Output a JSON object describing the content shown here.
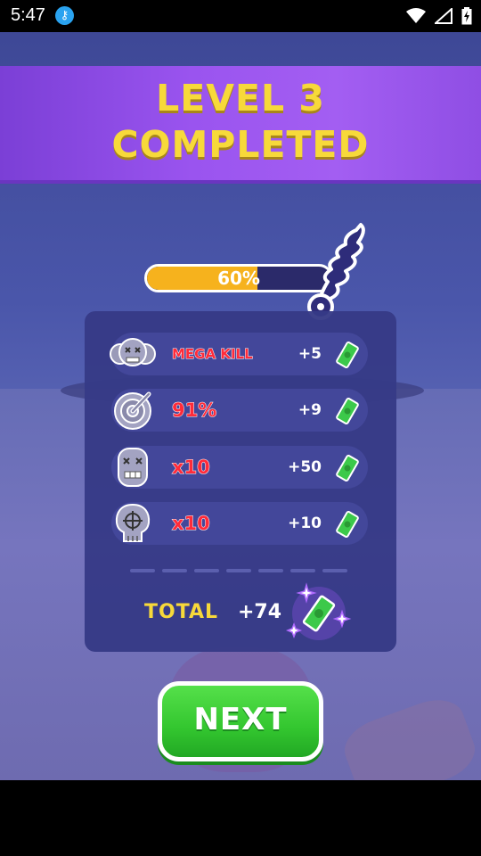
{
  "status_bar": {
    "time": "5:47"
  },
  "banner": {
    "line1": "LEVEL 3",
    "line2": "COMPLETED"
  },
  "progress": {
    "percent_label": "60%",
    "fraction": 0.6
  },
  "rewards": [
    {
      "label": "MEGA KILL",
      "value": "+5",
      "icon": "zombie-group-icon"
    },
    {
      "label": "91%",
      "value": "+9",
      "icon": "target-icon"
    },
    {
      "label": "x10",
      "value": "+50",
      "icon": "zombie-head-icon"
    },
    {
      "label": "x10",
      "value": "+10",
      "icon": "skull-crosshair-icon"
    }
  ],
  "total": {
    "label": "TOTAL",
    "value": "+74"
  },
  "next_button": {
    "label": "NEXT"
  },
  "colors": {
    "banner_text": "#f7d93a",
    "reward_label": "#ff2b3a",
    "progress_fill": "#f6b21d",
    "next_button": "#33c62f",
    "cash": "#3cc94a"
  }
}
